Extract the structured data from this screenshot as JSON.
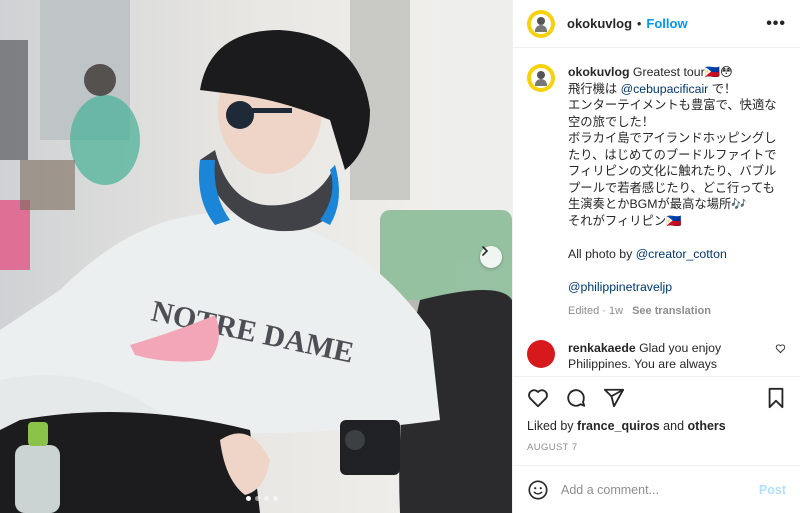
{
  "header": {
    "username": "okokuvlog",
    "separator": "•",
    "follow_label": "Follow",
    "more_label": "•••"
  },
  "caption": {
    "username": "okokuvlog",
    "line1": " Greatest tour🇵🇭😳",
    "line2_pre": "飛行機は ",
    "mention_airline": "@cebupacificair",
    "line2_post": " で！",
    "body": "エンターテイメントも豊富で、快適な空の旅でした！\nボラカイ島でアイランドホッピングしたり、はじめてのブードルファイトでフィリピンの文化に触れたり、バブルプールで若者感じたり、どこ行っても生演奏とかBGMが最高な場所🎶\nそれがフィリピン🇵🇭",
    "credit_pre": "All photo by ",
    "mention_creator": "@creator_cotton",
    "mention_tourism": "@philippinetraveljp",
    "edited": "Edited · 1w",
    "see_translation": "See translation"
  },
  "comment": {
    "username": "renkakaede",
    "text": " Glad you enjoy Philippines. You are always welcome here."
  },
  "likes": {
    "pre": "Liked by ",
    "user": "france_quiros",
    "mid": " and ",
    "others": "others"
  },
  "date": "AUGUST 7",
  "add_comment": {
    "placeholder": "Add a comment...",
    "post_label": "Post"
  },
  "icons": {
    "heart": "heart-icon",
    "comment": "comment-icon",
    "share": "paper-plane-icon",
    "save": "bookmark-icon",
    "emoji": "smiley-icon",
    "next": "chevron-right-icon"
  },
  "colors": {
    "accent": "#0095f6",
    "link": "#00376b",
    "muted": "#8e8e8e",
    "post_disabled": "#b2dffc"
  },
  "carousel": {
    "slides": 4,
    "active": 1
  }
}
